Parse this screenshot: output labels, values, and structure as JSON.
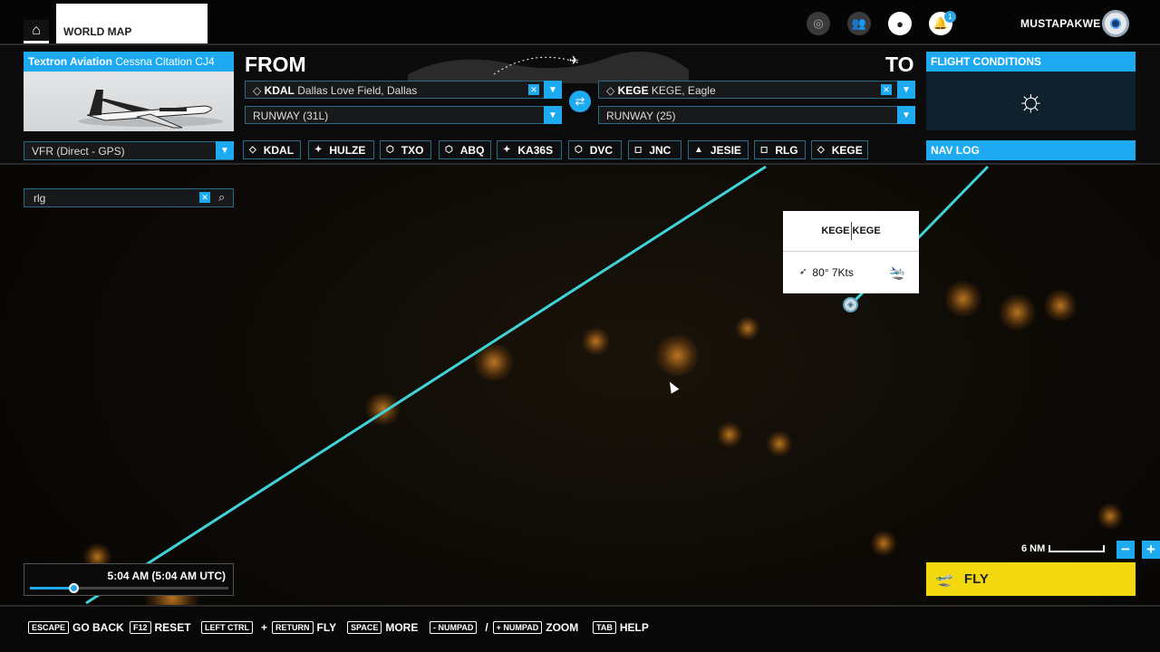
{
  "topbar": {
    "tab_label": "WORLD MAP",
    "username": "MUSTAPAKWE",
    "notification_count": "1"
  },
  "aircraft": {
    "maker": "Textron Aviation",
    "model": "Cessna Citation CJ4"
  },
  "from": {
    "heading": "FROM",
    "airport_code": "KDAL",
    "airport_name": "Dallas Love Field, Dallas",
    "runway": "RUNWAY (31L)"
  },
  "to": {
    "heading": "TO",
    "airport_code": "KEGE",
    "airport_name": "KEGE, Eagle",
    "runway": "RUNWAY (25)"
  },
  "flight_conditions": {
    "title": "FLIGHT CONDITIONS",
    "weather_icon": "sun-icon"
  },
  "nav_log": {
    "title": "NAV LOG"
  },
  "flight_plan": {
    "type": "VFR (Direct - GPS)",
    "waypoints": [
      {
        "label": "KDAL",
        "icon": "airport-icon",
        "glyph": "◇"
      },
      {
        "label": "HULZE",
        "icon": "intersection-icon",
        "glyph": "✦"
      },
      {
        "label": "TXO",
        "icon": "vor-icon",
        "glyph": "⬡"
      },
      {
        "label": "ABQ",
        "icon": "vor-icon",
        "glyph": "⬡"
      },
      {
        "label": "KA36S",
        "icon": "intersection-icon",
        "glyph": "✦"
      },
      {
        "label": "DVC",
        "icon": "vor-icon",
        "glyph": "⬡"
      },
      {
        "label": "JNC",
        "icon": "ndb-icon",
        "glyph": "◻"
      },
      {
        "label": "JESIE",
        "icon": "waypoint-icon",
        "glyph": "▲"
      },
      {
        "label": "RLG",
        "icon": "ndb-icon",
        "glyph": "◻"
      },
      {
        "label": "KEGE",
        "icon": "airport-icon",
        "glyph": "◇"
      }
    ]
  },
  "search": {
    "value": "rlg"
  },
  "airport_card": {
    "icao": "KEGE",
    "name": "KEGE",
    "wind": "80° 7Kts"
  },
  "map": {
    "scale_label": "6 NM"
  },
  "time": {
    "label": "5:04 AM (5:04 AM UTC)",
    "slider_fraction": 0.22
  },
  "fly_button": {
    "label": "FLY"
  },
  "hints": [
    {
      "keys": [
        "ESCAPE"
      ],
      "action": "GO BACK"
    },
    {
      "keys": [
        "F12"
      ],
      "action": "RESET"
    },
    {
      "keys": [
        "LEFT CTRL",
        "RETURN"
      ],
      "joiner": "+",
      "action": "FLY"
    },
    {
      "keys": [
        "SPACE"
      ],
      "action": "MORE"
    },
    {
      "keys": [
        "- NUMPAD",
        "+ NUMPAD"
      ],
      "joiner": "/",
      "action": "ZOOM"
    },
    {
      "keys": [
        "TAB"
      ],
      "action": "HELP"
    }
  ],
  "colors": {
    "accent": "#1eaaf1",
    "route": "#3fd2d6",
    "fly": "#f2d90f"
  }
}
